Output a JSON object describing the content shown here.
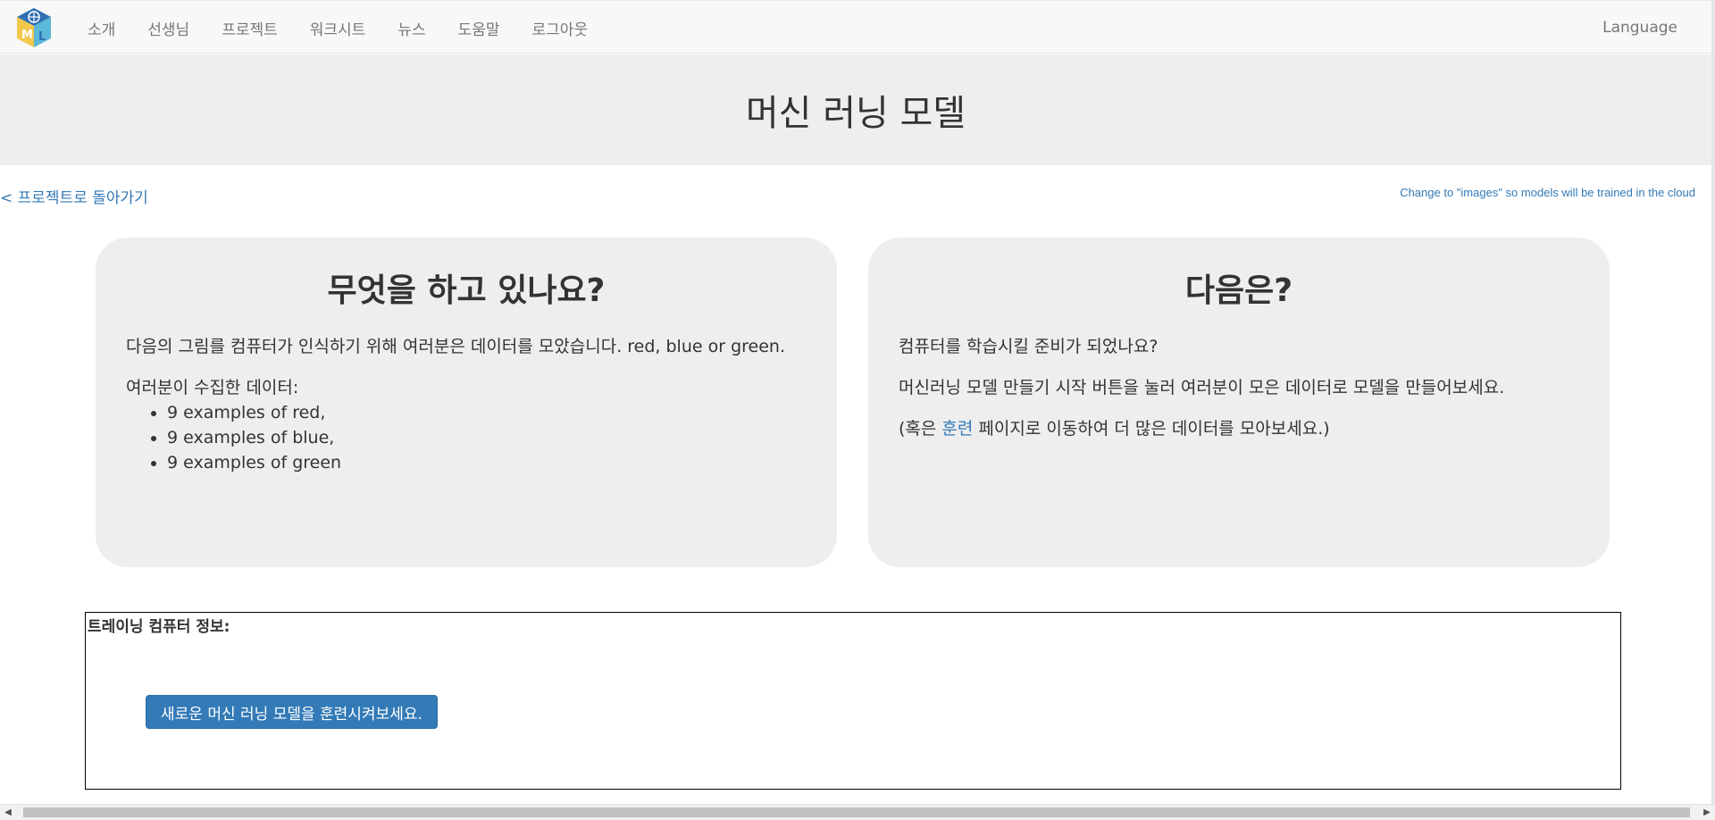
{
  "nav": {
    "items": [
      "소개",
      "선생님",
      "프로젝트",
      "워크시트",
      "뉴스",
      "도움말",
      "로그아웃"
    ],
    "language": "Language"
  },
  "page": {
    "title": "머신 러닝 모델",
    "back_link": "< 프로젝트로 돌아가기",
    "cloud_link": "Change to \"images\" so models will be trained in the cloud"
  },
  "left_panel": {
    "heading": "무엇을 하고 있나요?",
    "intro": "다음의 그림를 컴퓨터가 인식하기 위해 여러분은 데이터를 모았습니다. red, blue or green.",
    "data_label": "여러분이 수집한 데이터:",
    "data_items": [
      "9 examples of red,",
      "9 examples of blue,",
      "9 examples of green"
    ]
  },
  "right_panel": {
    "heading": "다음은?",
    "line1": "컴퓨터를 학습시킬 준비가 되었나요?",
    "line2": "머신러닝 모델 만들기 시작 버튼을 눌러 여러분이 모은 데이터로 모델을 만들어보세요.",
    "line3_pre": "(혹은 ",
    "line3_link": "훈련",
    "line3_post": " 페이지로 이동하여 더 많은 데이터를 모아보세요.)"
  },
  "training": {
    "label": "트레이닝 컴퓨터 정보:",
    "button": "새로운 머신 러닝 모델을 훈련시켜보세요."
  },
  "icons": {
    "logo": "ml-cube-logo-icon",
    "scroll_left": "arrow-left-icon",
    "scroll_right": "arrow-right-icon"
  },
  "colors": {
    "link": "#337ab7",
    "button": "#337ab7",
    "panel_bg": "#eeeeee",
    "nav_bg": "#f8f8f8"
  }
}
